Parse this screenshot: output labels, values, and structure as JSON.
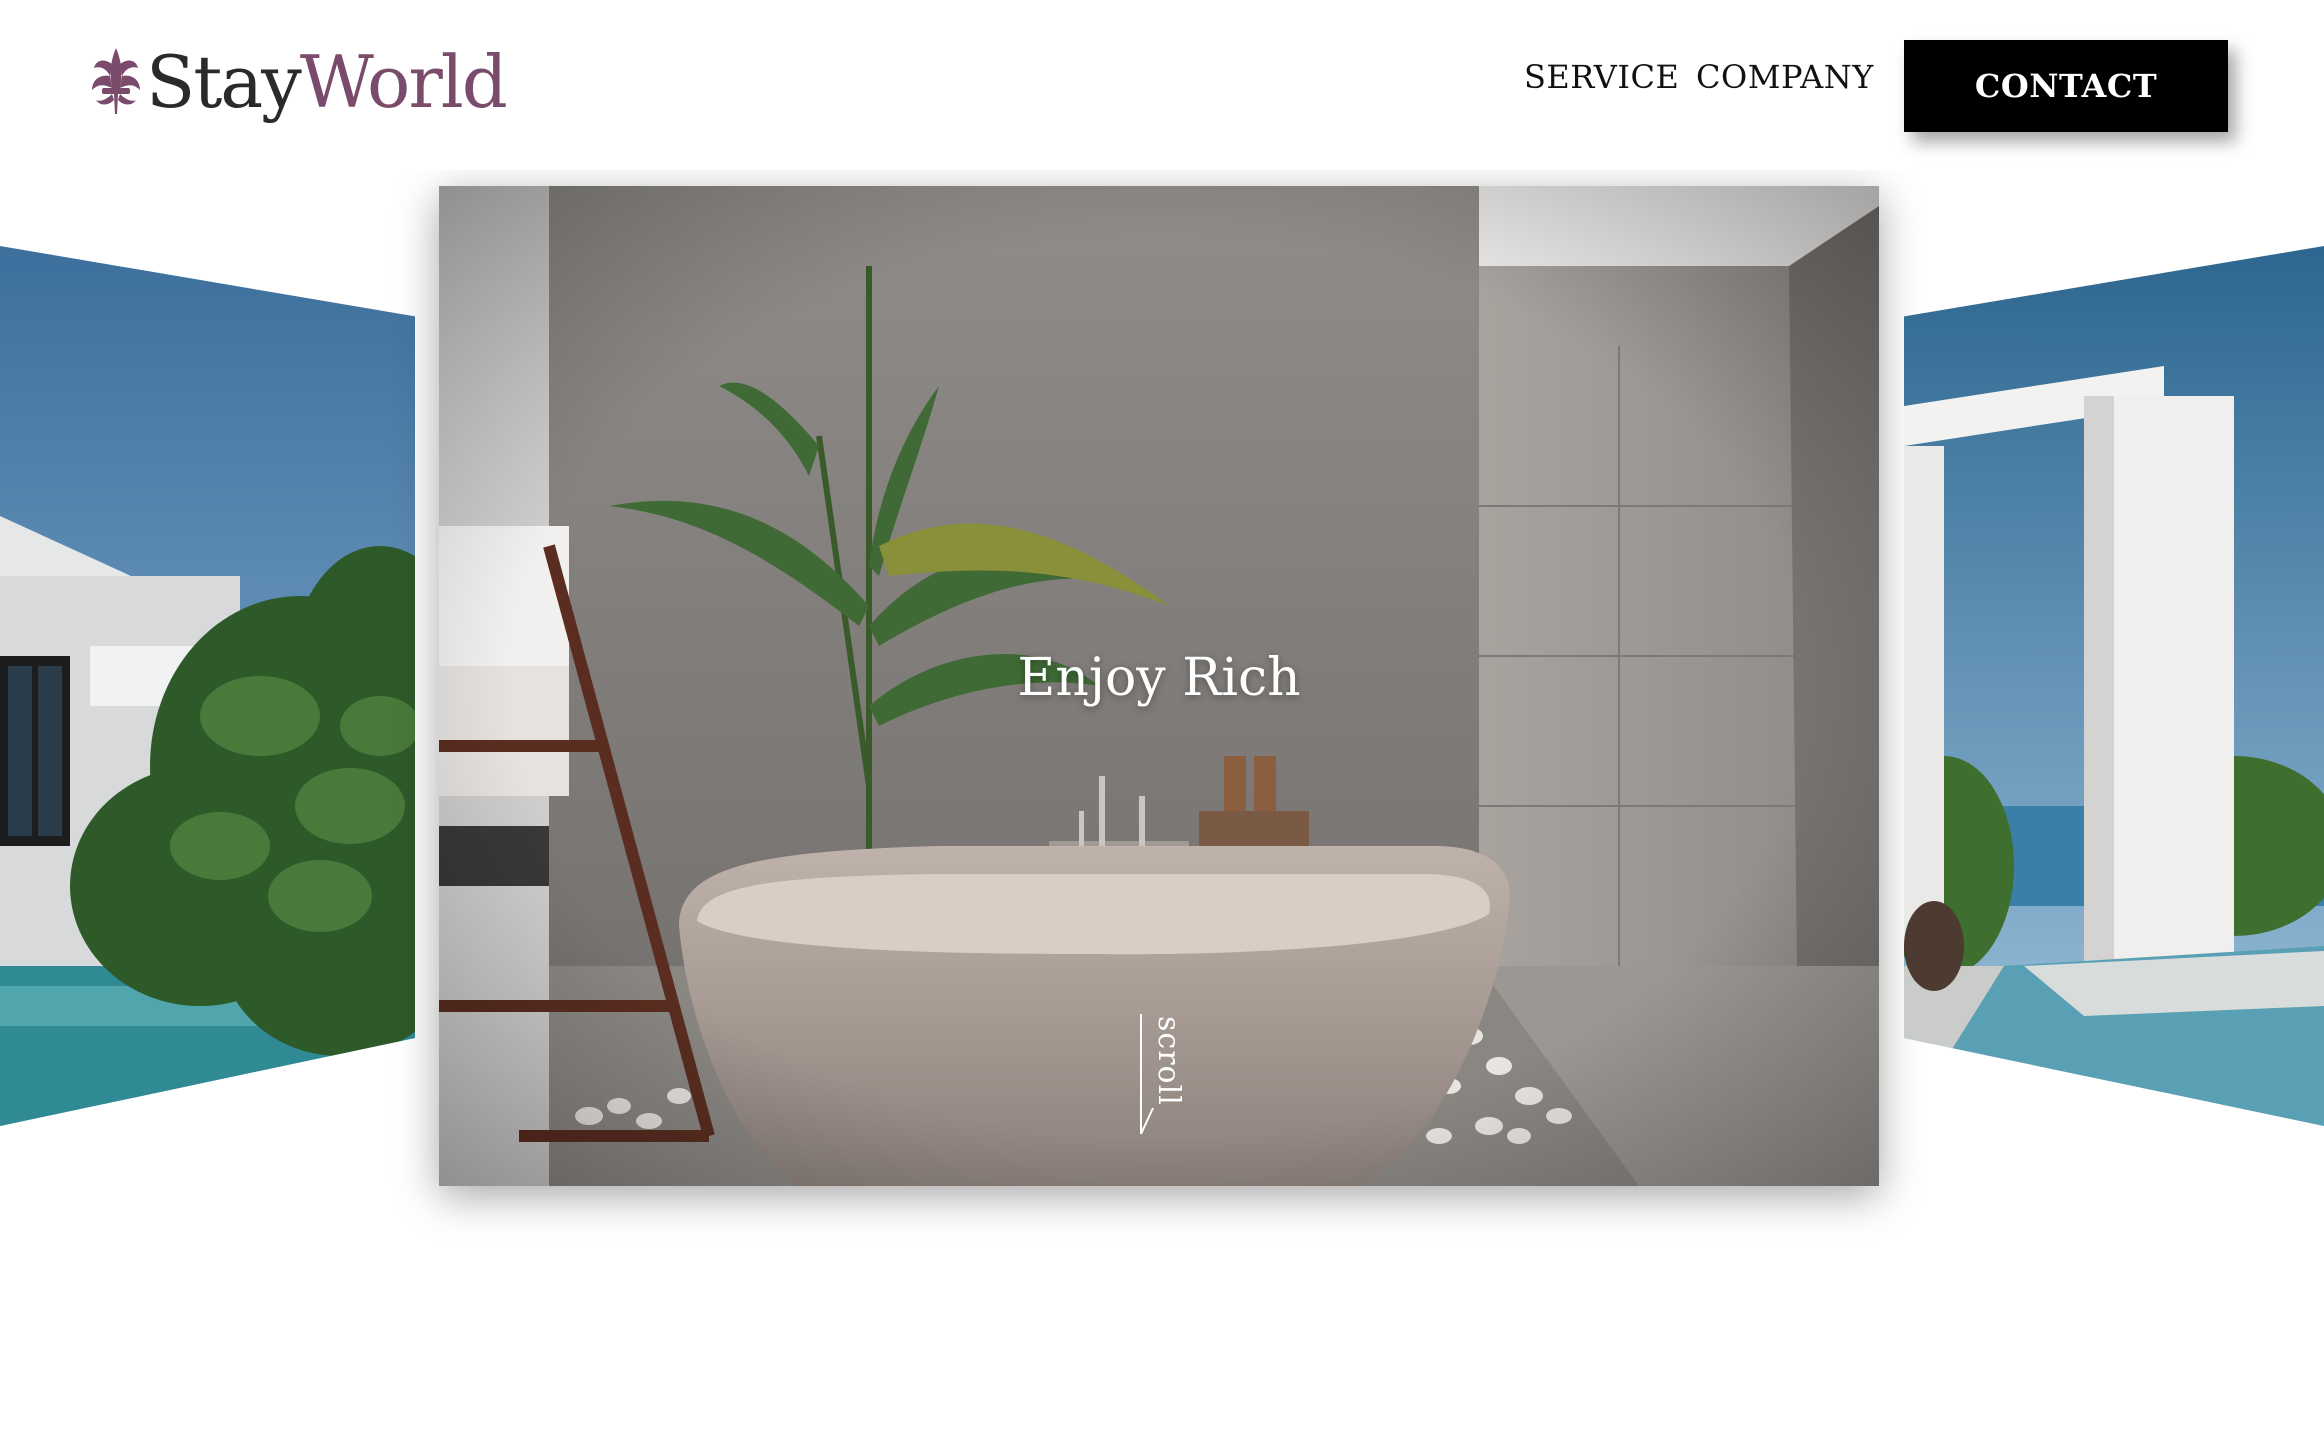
{
  "brand": {
    "name_part1": "Stay",
    "name_part2": "World",
    "logo_icon": "fleur-de-lis-icon",
    "color_dark": "#2a2a2a",
    "color_accent": "#7a4b6b"
  },
  "nav": {
    "items": [
      {
        "label": "SERVICE"
      },
      {
        "label": "COMPANY"
      }
    ],
    "contact_label": "CONTACT"
  },
  "hero": {
    "title": "Enjoy Rich",
    "scroll_label": "scroll"
  },
  "carousel": {
    "slides": [
      {
        "subject": "villa exterior with plants and pool"
      },
      {
        "subject": "outdoor bathtub with palm plant"
      },
      {
        "subject": "infinity pool with ocean view"
      }
    ]
  }
}
